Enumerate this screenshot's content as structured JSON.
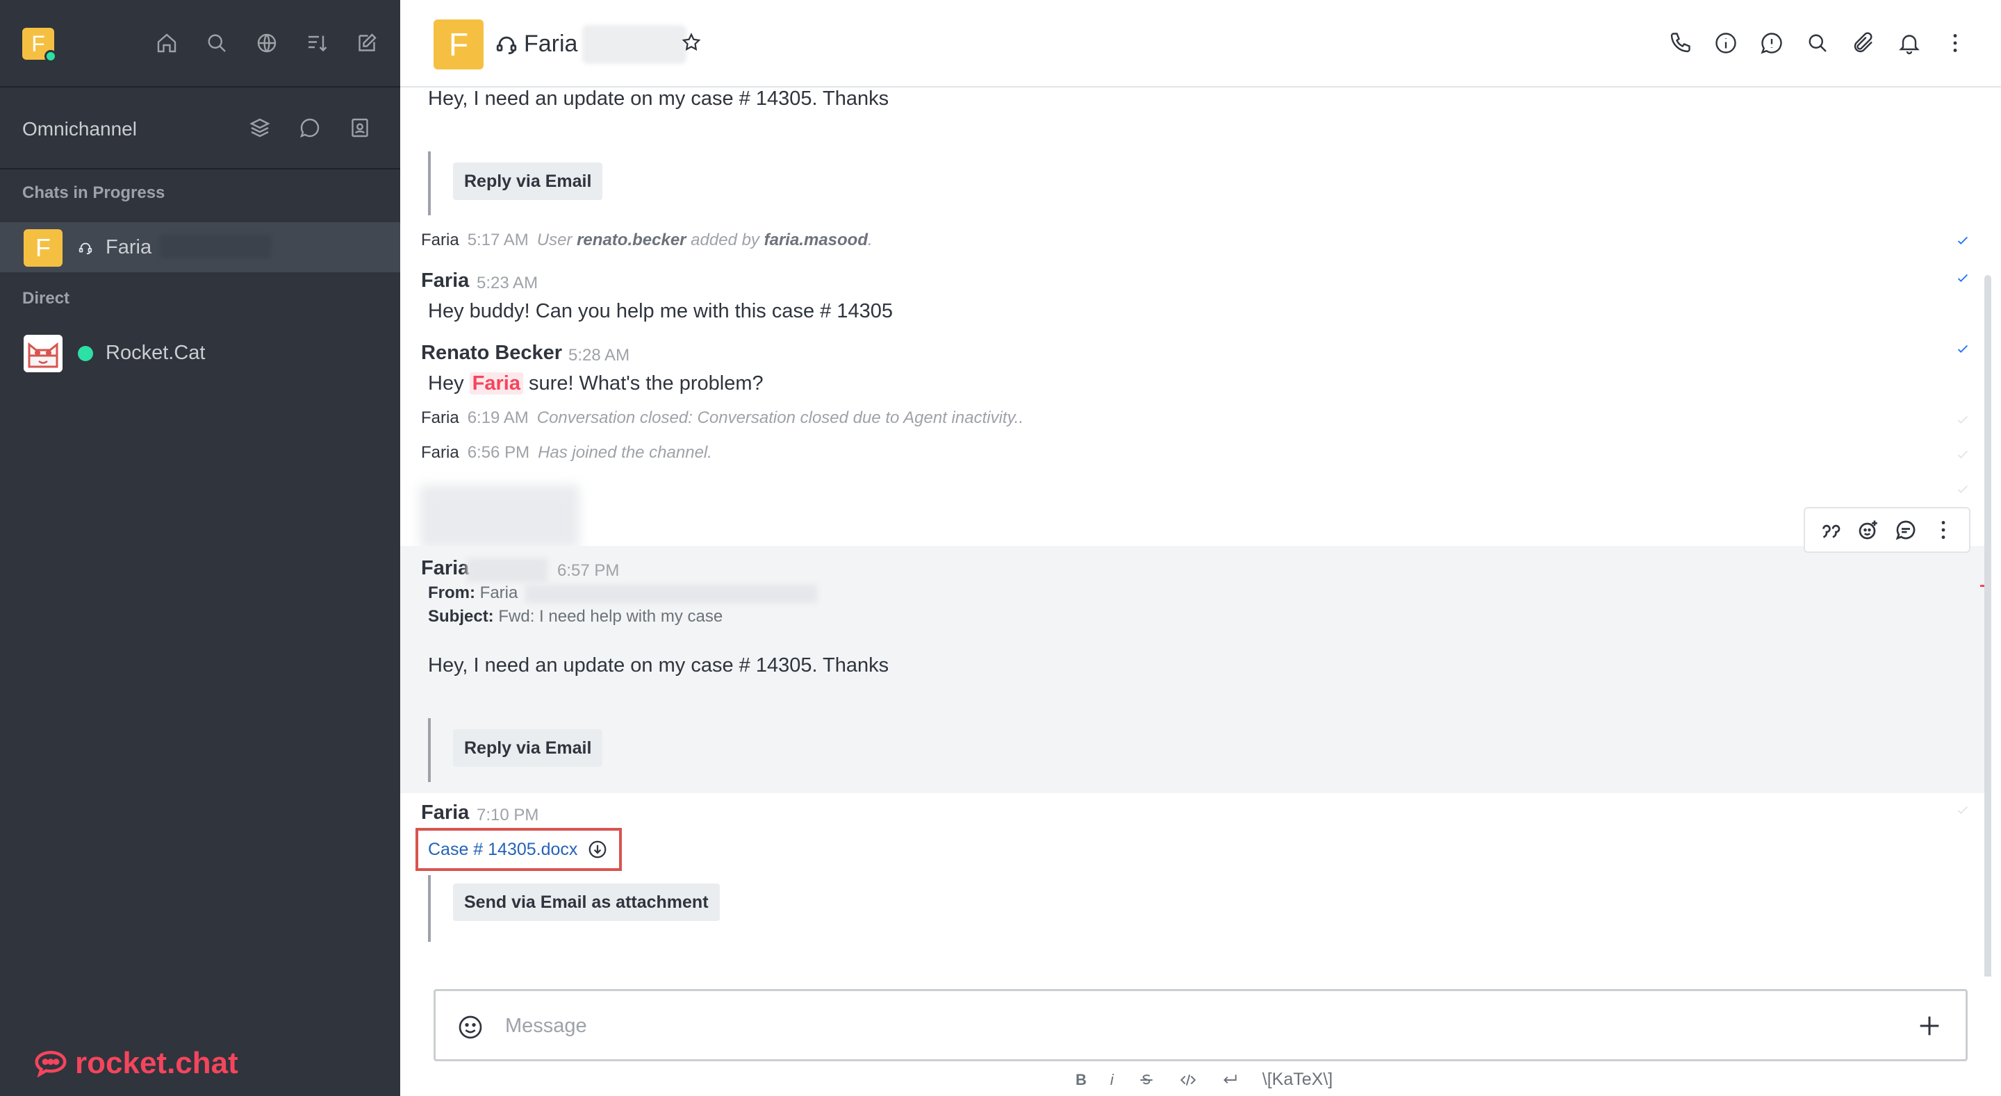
{
  "workspace": {
    "avatar_letter": "F"
  },
  "sidebar": {
    "section_label": "Omnichannel",
    "groups": [
      {
        "label": "Chats in Progress"
      },
      {
        "label": "Direct"
      }
    ],
    "rooms": [
      {
        "avatar_letter": "F",
        "name": "Faria",
        "active": true
      },
      {
        "name": "Rocket.Cat",
        "status": "online"
      }
    ],
    "logo_text": "rocket.chat"
  },
  "header": {
    "avatar_letter": "F",
    "title": "Faria"
  },
  "messages": [
    {
      "type": "email-body",
      "text": "Hey, I need an update on my case # 14305. Thanks",
      "button": "Reply via Email"
    },
    {
      "type": "system",
      "author": "Faria",
      "time": "5:17 AM",
      "pre": "User",
      "user": "renato.becker",
      "mid": "added by",
      "by": "faria.masood",
      "end": "."
    },
    {
      "type": "message",
      "author": "Faria",
      "time": "5:23 AM",
      "text": "Hey buddy! Can you help me with this case # 14305"
    },
    {
      "type": "message",
      "author": "Renato Becker",
      "time": "5:28 AM",
      "text_before": "Hey",
      "mention": "Faria",
      "text_after": "sure! What's the problem?"
    },
    {
      "type": "system",
      "author": "Faria",
      "time": "6:19 AM",
      "text": "Conversation closed: Conversation closed due to Agent inactivity.."
    },
    {
      "type": "system",
      "author": "Faria",
      "time": "6:56 PM",
      "text": "Has joined the channel."
    },
    {
      "type": "email",
      "author": "Faria",
      "time": "6:57 PM",
      "from_label": "From:",
      "from_value": "Faria",
      "subject_label": "Subject:",
      "subject_value": "Fwd: I need help with my case",
      "text": "Hey, I need an update on my case # 14305. Thanks",
      "button": "Reply via Email"
    },
    {
      "type": "file",
      "author": "Faria",
      "time": "7:10 PM",
      "file_name": "Case # 14305.docx",
      "button": "Send via Email as attachment"
    }
  ],
  "composer": {
    "placeholder": "Message"
  },
  "formatting": {
    "bold": "B",
    "italic": "i",
    "katex": "\\[KaTeX\\]"
  },
  "colors": {
    "sidebar_bg": "#2f343d",
    "accent_yellow": "#f5c042",
    "mention_red": "#f5455c",
    "online": "#2de0a5",
    "highlight_border": "#d9534f"
  }
}
